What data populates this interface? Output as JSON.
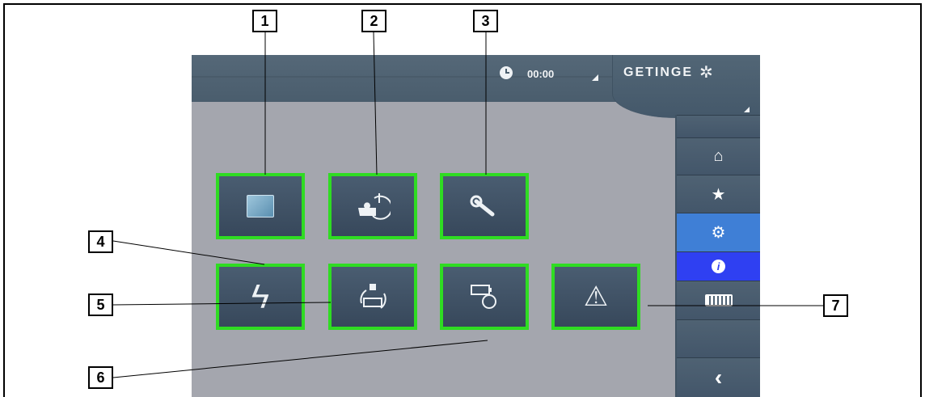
{
  "callouts": [
    "1",
    "2",
    "3",
    "4",
    "5",
    "6",
    "7"
  ],
  "status_bar": {
    "time": "00:00",
    "brand": "GETINGE",
    "brand_icon": "✲"
  },
  "tiles": {
    "t1": {
      "icon": "screen-icon"
    },
    "t2": {
      "icon": "puzzle-timer-icon"
    },
    "t3": {
      "icon": "wrench-icon"
    },
    "t4": {
      "icon": "lightning-icon",
      "glyph": "ϟ"
    },
    "t5": {
      "icon": "plug-battery-cycle-icon"
    },
    "t6": {
      "icon": "battery-clock-icon"
    },
    "t7": {
      "icon": "warning-icon",
      "glyph": "⚠"
    }
  },
  "sidebar": {
    "home": {
      "glyph": "⌂"
    },
    "favorites": {
      "glyph": "★"
    },
    "settings": {
      "glyph": "⚙"
    },
    "info": {
      "glyph": "i"
    },
    "battery": {
      "glyph": "▭"
    },
    "back": {
      "glyph": "‹"
    }
  },
  "colors": {
    "tile_border": "#2fdc22",
    "screen_bg": "#a4a6ae",
    "topbar": "#4a5d6d",
    "settings_active": "#3f7fd6",
    "info_active": "#2f40f2"
  }
}
